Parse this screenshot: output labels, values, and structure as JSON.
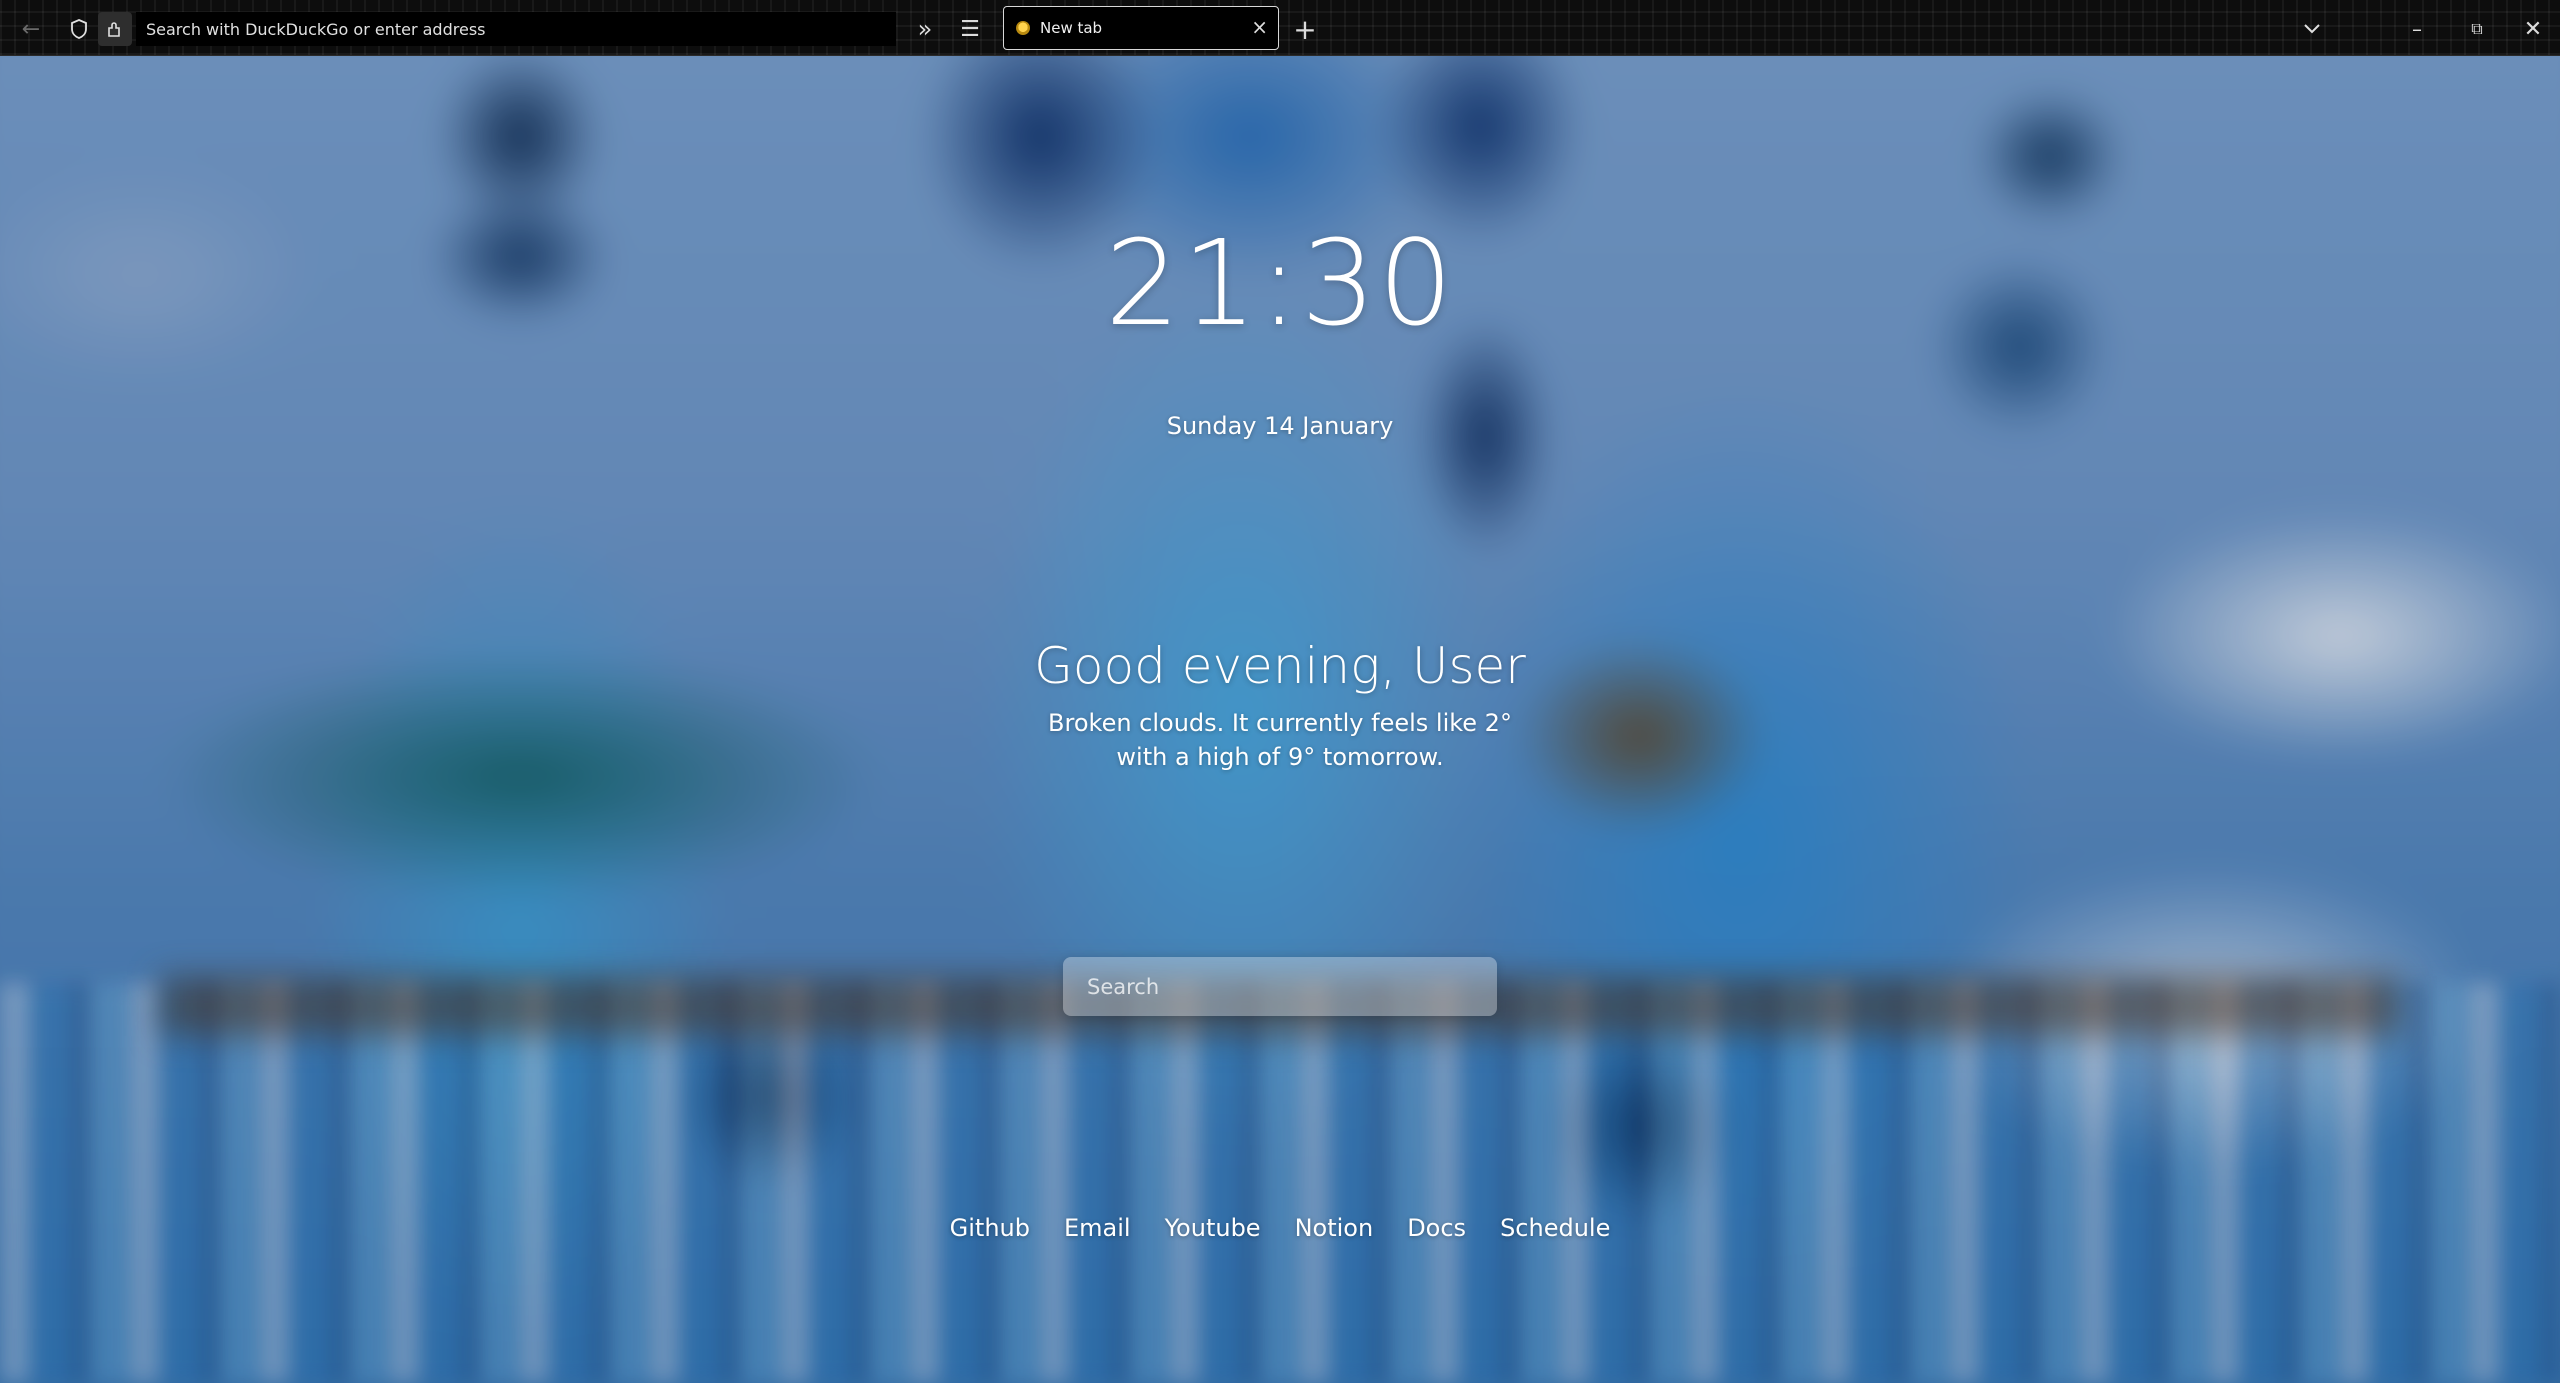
{
  "browser": {
    "address_placeholder": "Search with DuckDuckGo or enter address",
    "tab_title": "New tab"
  },
  "page": {
    "time": "21:30",
    "date": "Sunday 14 January",
    "greeting": "Good evening, User",
    "weather_line1": "Broken clouds. It currently feels like 2°",
    "weather_line2": "with a high of 9° tomorrow.",
    "search_placeholder": "Search",
    "links": [
      "Github",
      "Email",
      "Youtube",
      "Notion",
      "Docs",
      "Schedule"
    ]
  }
}
